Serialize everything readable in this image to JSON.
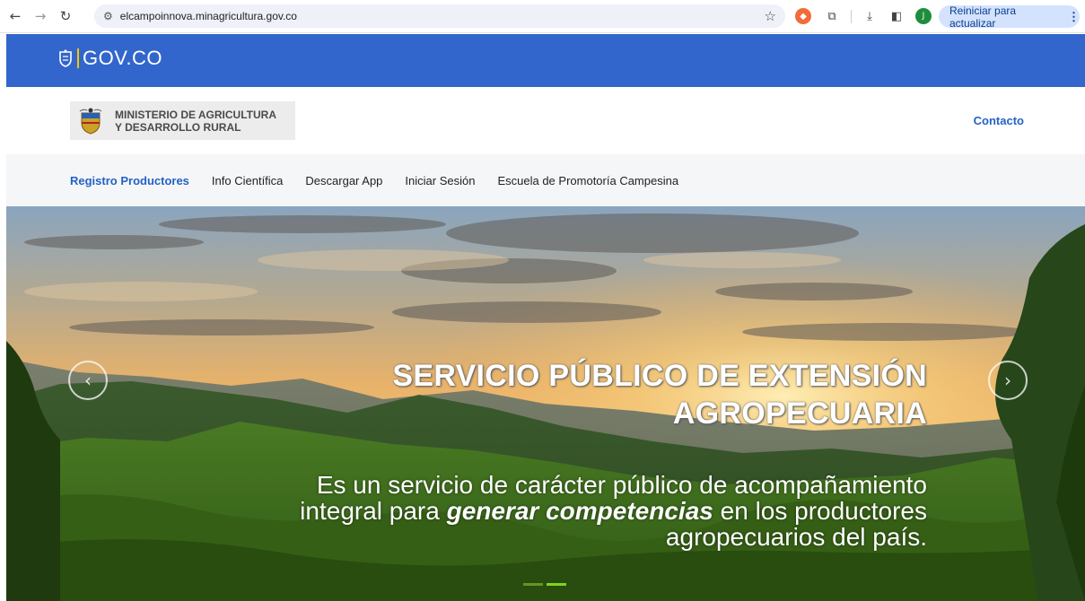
{
  "browser": {
    "url": "elcampoinnova.minagricultura.gov.co",
    "update_label": "Reiniciar para actualizar",
    "avatar_initial": "J",
    "icons": [
      "back-icon",
      "forward-icon",
      "reload-icon",
      "site-settings-icon",
      "bookmark-star-icon",
      "extension-icon",
      "puzzle-icon",
      "download-icon",
      "side-panel-icon",
      "avatar-icon",
      "menu-dots-icon"
    ]
  },
  "govbar": {
    "logo_text": "GOV.CO",
    "color": "#3366cc"
  },
  "ministry": {
    "name_line1": "MINISTERIO DE AGRICULTURA",
    "name_line2": "Y DESARROLLO RURAL",
    "contact_label": "Contacto"
  },
  "nav": {
    "items": [
      {
        "label": "Registro Productores",
        "active": true
      },
      {
        "label": "Info Científica"
      },
      {
        "label": "Descargar App"
      },
      {
        "label": "Iniciar Sesión"
      },
      {
        "label": "Escuela de Promotoría Campesina"
      }
    ]
  },
  "hero": {
    "title_line1": "SERVICIO PÚBLICO DE EXTENSIÓN",
    "title_line2": "AGROPECUARIA",
    "sub_part1": "Es un servicio de carácter público de acompañamiento",
    "sub_part2": "integral para ",
    "sub_emph": "generar competencias",
    "sub_part3": " en los productores",
    "sub_part4": "agropecuarios del país.",
    "accent_color": "#7ed321"
  }
}
